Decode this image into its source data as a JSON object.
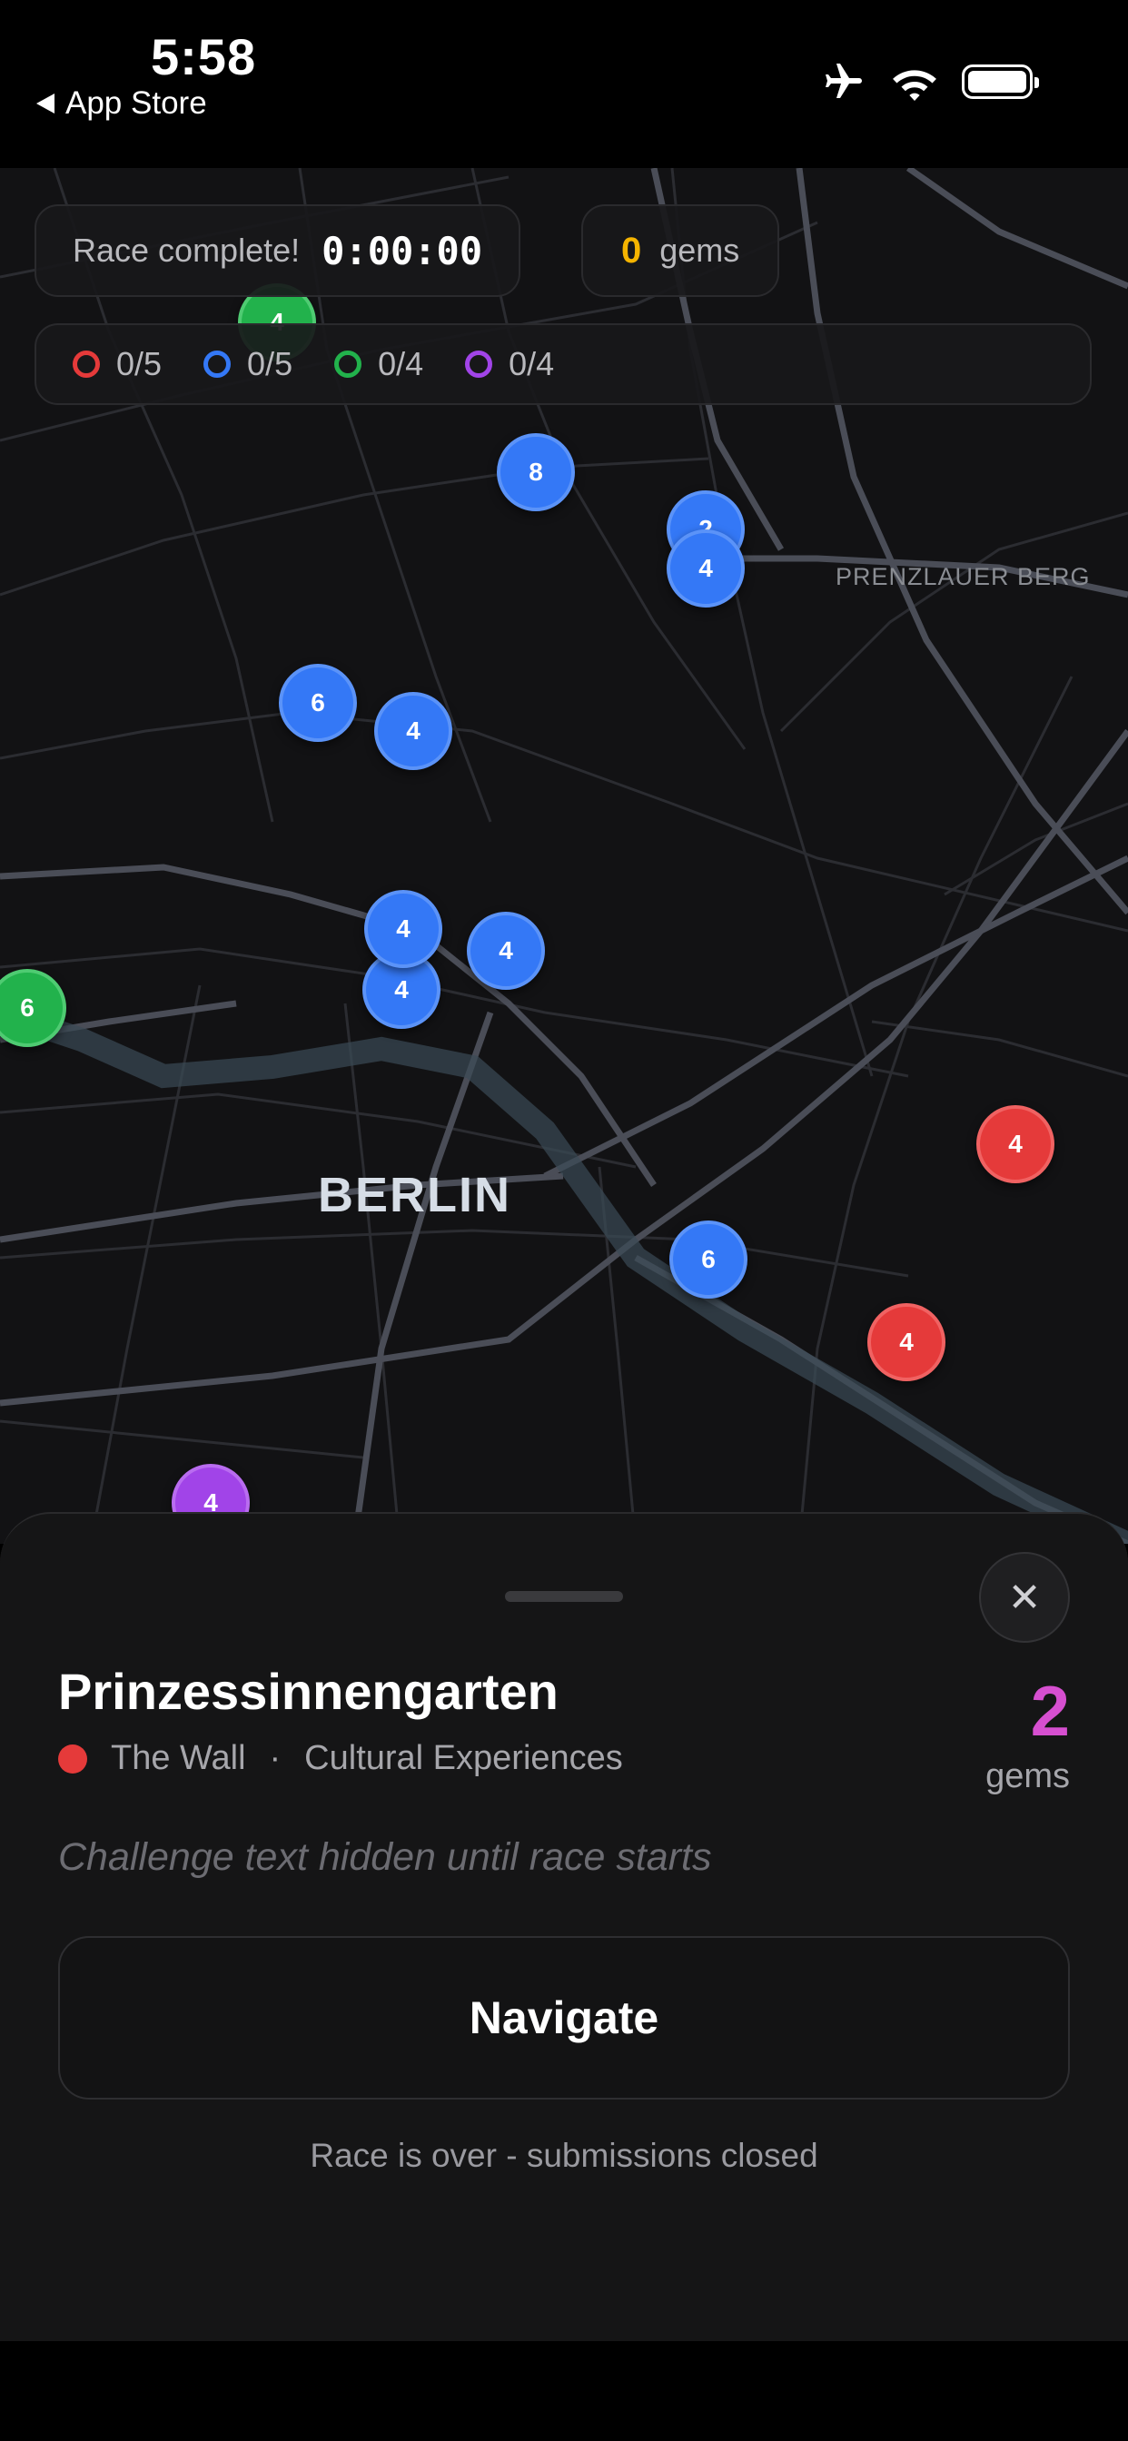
{
  "status_bar": {
    "time": "5:58",
    "back_label": "App Store"
  },
  "race": {
    "status_label": "Race complete!",
    "timer": "0:00:00",
    "gems_count": "0",
    "gems_label": "gems"
  },
  "progress": [
    {
      "color": "#e53a3a",
      "text": "0/5"
    },
    {
      "color": "#3478f6",
      "text": "0/5"
    },
    {
      "color": "#22b24c",
      "text": "0/4"
    },
    {
      "color": "#a144e8",
      "text": "0/4"
    }
  ],
  "map": {
    "city_label": "BERLIN",
    "district_label": "PRENZLAUER BERG",
    "pins": [
      {
        "label": "4",
        "color": "green"
      },
      {
        "label": "8",
        "color": "blue"
      },
      {
        "label": "2",
        "color": "blue"
      },
      {
        "label": "4",
        "color": "blue"
      },
      {
        "label": "6",
        "color": "blue"
      },
      {
        "label": "4",
        "color": "blue"
      },
      {
        "label": "4",
        "color": "blue"
      },
      {
        "label": "4",
        "color": "blue"
      },
      {
        "label": "4",
        "color": "blue"
      },
      {
        "label": "6",
        "color": "green"
      },
      {
        "label": "4",
        "color": "red"
      },
      {
        "label": "6",
        "color": "blue"
      },
      {
        "label": "4",
        "color": "red"
      },
      {
        "label": "4",
        "color": "purple"
      }
    ]
  },
  "sheet": {
    "title": "Prinzessinnengarten",
    "category_color": "#e53a3a",
    "category": "The Wall",
    "separator": "·",
    "subcategory": "Cultural Experiences",
    "gem_value": "2",
    "gem_unit": "gems",
    "challenge_text": "Challenge text hidden until race starts",
    "navigate_label": "Navigate",
    "footer_note": "Race is over - submissions closed",
    "close_symbol": "✕"
  },
  "icons": {
    "airplane": "airplane-icon",
    "wifi": "wifi-icon",
    "battery": "battery-icon"
  }
}
